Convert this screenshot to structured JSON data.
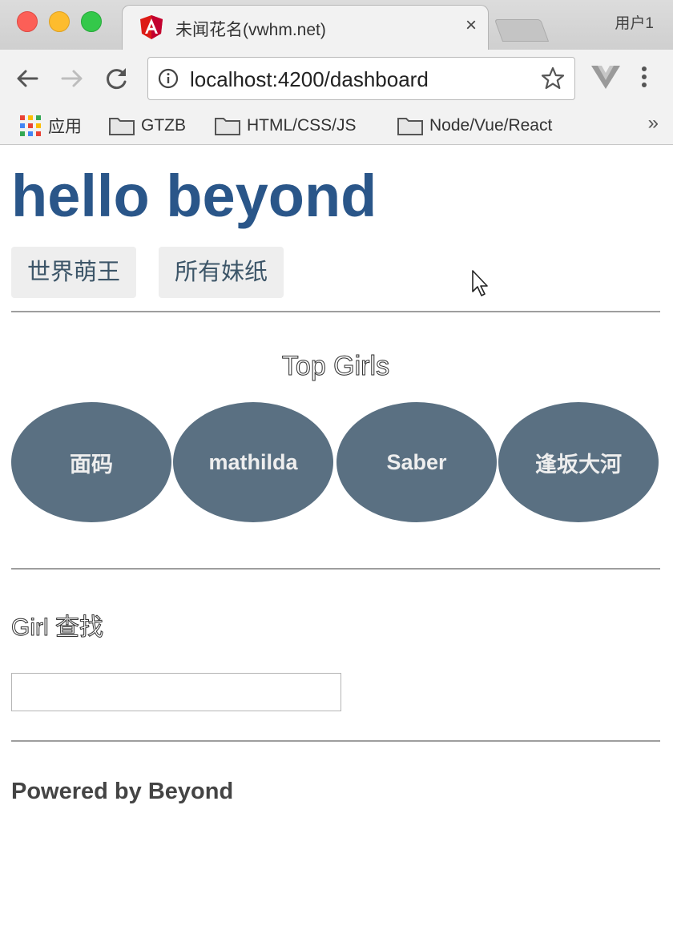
{
  "browser": {
    "tab": {
      "title": "未闻花名(vwhm.net)",
      "close_glyph": "×",
      "favicon": "angular-icon"
    },
    "profile_label": "用户1",
    "address_bar": {
      "url": "localhost:4200/dashboard"
    },
    "bookmarks": [
      {
        "label": "应用",
        "icon": "apps-grid-icon"
      },
      {
        "label": "GTZB",
        "icon": "folder-icon"
      },
      {
        "label": "HTML/CSS/JS",
        "icon": "folder-icon"
      },
      {
        "label": "Node/Vue/React",
        "icon": "folder-icon"
      }
    ],
    "bookmarks_overflow": "»"
  },
  "page": {
    "title": "hello beyond",
    "nav": [
      {
        "label": "世界萌王"
      },
      {
        "label": "所有妹纸"
      }
    ],
    "top_section": {
      "heading": "Top Girls",
      "girls": [
        {
          "name": "面码"
        },
        {
          "name": "mathilda"
        },
        {
          "name": "Saber"
        },
        {
          "name": "逢坂大河"
        }
      ],
      "card_color": "#5a7082"
    },
    "search": {
      "label": "Girl 查找",
      "value": ""
    },
    "footer": {
      "text": "Powered by Beyond"
    },
    "colors": {
      "title": "#2a5689",
      "nav_button_bg": "#eeeeee",
      "nav_button_text": "#3c5568"
    }
  }
}
